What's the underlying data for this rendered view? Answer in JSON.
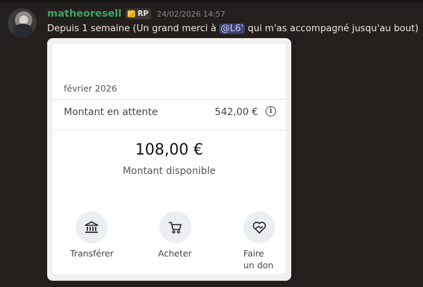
{
  "message": {
    "username": "matheoresell",
    "role_badge": "RP",
    "timestamp": "24/02/2026 14:57",
    "text_before": "Depuis 1 semaine (Un grand merci à ",
    "mention": "@L6'",
    "text_after": " qui m'as accompagné jusqu'au bout)",
    "colors": {
      "username": "#3ba55d",
      "mention_bg": "#3d4270",
      "background": "#221f1d"
    }
  },
  "card": {
    "month": "février 2026",
    "pending_label": "Montant en attente",
    "pending_amount": "542,00 €",
    "info_icon": "info-icon",
    "balance": "108,00 €",
    "balance_label": "Montant disponible",
    "actions": [
      {
        "label": "Transférer",
        "icon": "bank-icon"
      },
      {
        "label": "Acheter",
        "icon": "cart-icon"
      },
      {
        "label_line1": "Faire",
        "label_line2": "un don",
        "icon": "heart-hand-icon"
      }
    ]
  }
}
